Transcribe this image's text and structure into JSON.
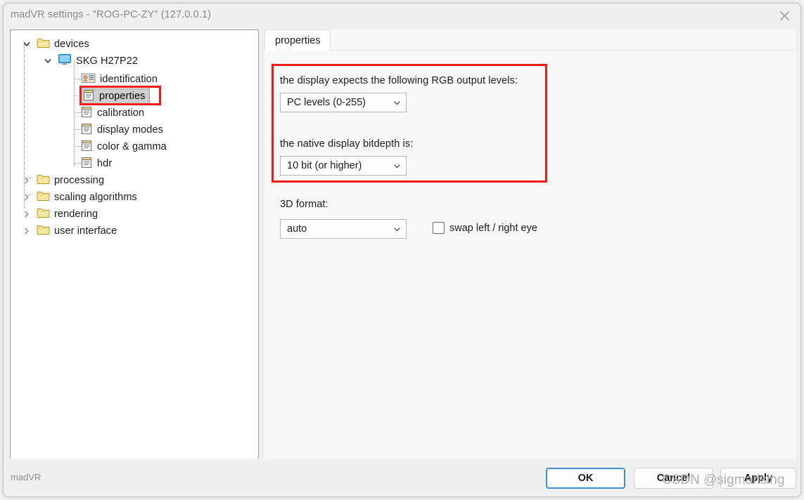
{
  "window": {
    "title": "madVR settings - \"ROG-PC-ZY\" (127.0.0.1)",
    "close_icon": "close-icon"
  },
  "tree": {
    "items": [
      {
        "label": "devices",
        "icon": "folder-icon",
        "expander": "chevron-down-icon",
        "depth": 0,
        "selected": false
      },
      {
        "label": "SKG H27P22",
        "icon": "monitor-icon",
        "expander": "chevron-down-icon",
        "depth": 1,
        "selected": false
      },
      {
        "label": "identification",
        "icon": "id-card-icon",
        "expander": "",
        "depth": 2,
        "selected": false
      },
      {
        "label": "properties",
        "icon": "note-icon",
        "expander": "",
        "depth": 2,
        "selected": true
      },
      {
        "label": "calibration",
        "icon": "note-icon",
        "expander": "",
        "depth": 2,
        "selected": false
      },
      {
        "label": "display modes",
        "icon": "note-icon",
        "expander": "",
        "depth": 2,
        "selected": false
      },
      {
        "label": "color & gamma",
        "icon": "note-icon",
        "expander": "",
        "depth": 2,
        "selected": false
      },
      {
        "label": "hdr",
        "icon": "note-icon",
        "expander": "",
        "depth": 2,
        "selected": false
      },
      {
        "label": "processing",
        "icon": "folder-icon",
        "expander": "chevron-right-icon",
        "depth": 0,
        "selected": false
      },
      {
        "label": "scaling algorithms",
        "icon": "folder-icon",
        "expander": "chevron-right-icon",
        "depth": 0,
        "selected": false
      },
      {
        "label": "rendering",
        "icon": "folder-icon",
        "expander": "chevron-right-icon",
        "depth": 0,
        "selected": false
      },
      {
        "label": "user interface",
        "icon": "folder-icon",
        "expander": "chevron-right-icon",
        "depth": 0,
        "selected": false
      }
    ]
  },
  "main": {
    "tab_label": "properties",
    "rgb_levels_label": "the display expects the following RGB output levels:",
    "rgb_levels_value": "PC levels (0-255)",
    "bitdepth_label": "the native display bitdepth is:",
    "bitdepth_value": "10 bit (or higher)",
    "format3d_label": "3D format:",
    "format3d_value": "auto",
    "swap_eye_label": "swap left / right eye",
    "swap_eye_checked": false,
    "highlight_color": "#ef1a1a"
  },
  "footer": {
    "brand": "madVR",
    "ok_label": "OK",
    "cancel_label": "Cancel",
    "apply_label": "Apply"
  },
  "watermark": {
    "text": "CSDN @sigmarising"
  }
}
